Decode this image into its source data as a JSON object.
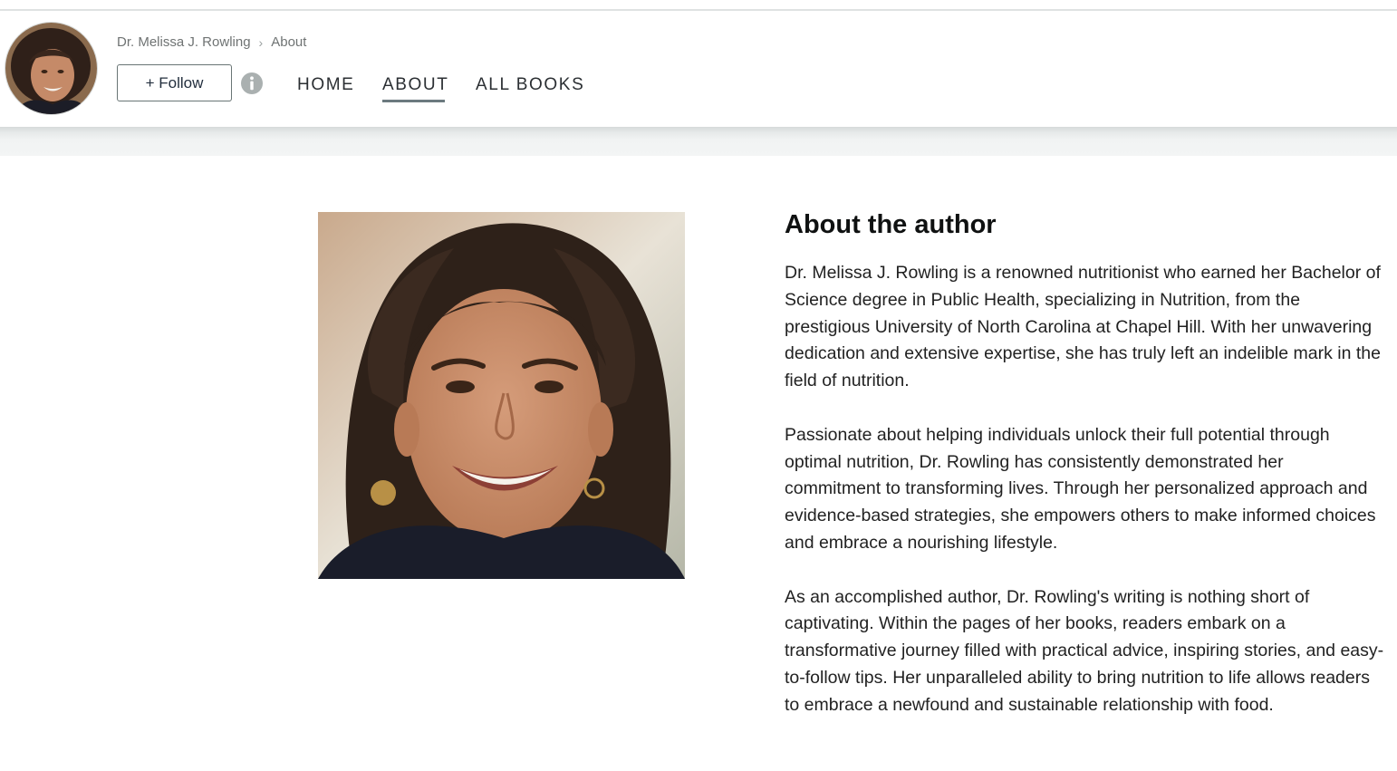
{
  "header": {
    "breadcrumb": {
      "author": "Dr. Melissa J. Rowling",
      "separator": "›",
      "current": "About"
    },
    "follow_label": "+ Follow",
    "nav": [
      {
        "label": "HOME",
        "active": false
      },
      {
        "label": "ABOUT",
        "active": true
      },
      {
        "label": "ALL BOOKS",
        "active": false
      }
    ]
  },
  "main": {
    "heading": "About the author",
    "paragraphs": [
      "Dr. Melissa J. Rowling is a renowned nutritionist who earned her Bachelor of Science degree in Public Health, specializing in Nutrition, from the prestigious University of North Carolina at Chapel Hill. With her unwavering dedication and extensive expertise, she has truly left an indelible mark in the field of nutrition.",
      "Passionate about helping individuals unlock their full potential through optimal nutrition, Dr. Rowling has consistently demonstrated her commitment to transforming lives. Through her personalized approach and evidence-based strategies, she empowers others to make informed choices and embrace a nourishing lifestyle.",
      "As an accomplished author, Dr. Rowling's writing is nothing short of captivating. Within the pages of her books, readers embark on a transformative journey filled with practical advice, inspiring stories, and easy-to-follow tips. Her unparalleled ability to bring nutrition to life allows readers to embrace a newfound and sustainable relationship with food."
    ]
  },
  "icons": {
    "info": "info-icon",
    "breadcrumb_separator": "chevron-right-icon"
  },
  "colors": {
    "nav_underline": "#6c7a7f",
    "button_border": "#697575",
    "header_shadow": "#d6dada"
  }
}
